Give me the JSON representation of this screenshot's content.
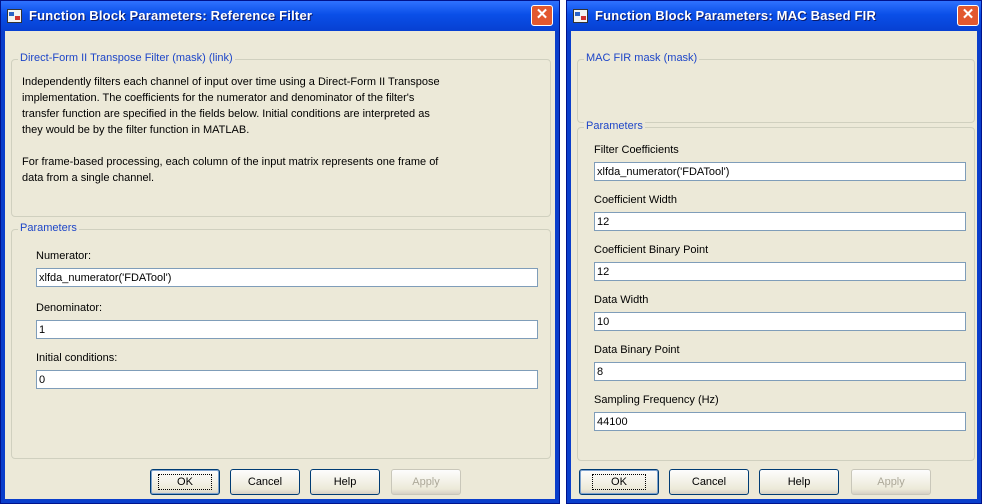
{
  "left_dialog": {
    "title": "Function Block Parameters: Reference Filter",
    "mask_group_label": "Direct-Form II Transpose Filter (mask) (link)",
    "description_lines": [
      "Independently filters each channel of input over time using a Direct-Form II Transpose",
      "implementation.  The coefficients for the numerator and denominator of the filter's",
      "transfer function are specified in the fields below.  Initial conditions are interpreted as",
      "they would be by the filter function in MATLAB.",
      "",
      "For frame-based processing, each column of the input matrix represents one frame of",
      "data from a single channel."
    ],
    "params_label": "Parameters",
    "fields": [
      {
        "label": "Numerator:",
        "value": "xlfda_numerator('FDATool')"
      },
      {
        "label": "Denominator:",
        "value": "1"
      },
      {
        "label": "Initial conditions:",
        "value": "0"
      }
    ],
    "buttons": {
      "ok": "OK",
      "cancel": "Cancel",
      "help": "Help",
      "apply": "Apply"
    }
  },
  "right_dialog": {
    "title": "Function Block Parameters: MAC Based FIR",
    "mask_group_label": "MAC FIR mask (mask)",
    "params_label": "Parameters",
    "fields": [
      {
        "label": "Filter Coefficients",
        "value": "xlfda_numerator('FDATool')"
      },
      {
        "label": "Coefficient Width",
        "value": "12"
      },
      {
        "label": "Coefficient Binary Point",
        "value": "12"
      },
      {
        "label": "Data Width",
        "value": "10"
      },
      {
        "label": "Data Binary Point",
        "value": "8"
      },
      {
        "label": "Sampling Frequency (Hz)",
        "value": "44100"
      }
    ],
    "buttons": {
      "ok": "OK",
      "cancel": "Cancel",
      "help": "Help",
      "apply": "Apply"
    }
  },
  "icons": {
    "app": "simulink-block-icon",
    "close": "close-icon"
  },
  "colors": {
    "titlebar": "#0a4fe8",
    "client": "#ece9d8",
    "group_label": "#1e46c8",
    "close": "#e2582f"
  }
}
